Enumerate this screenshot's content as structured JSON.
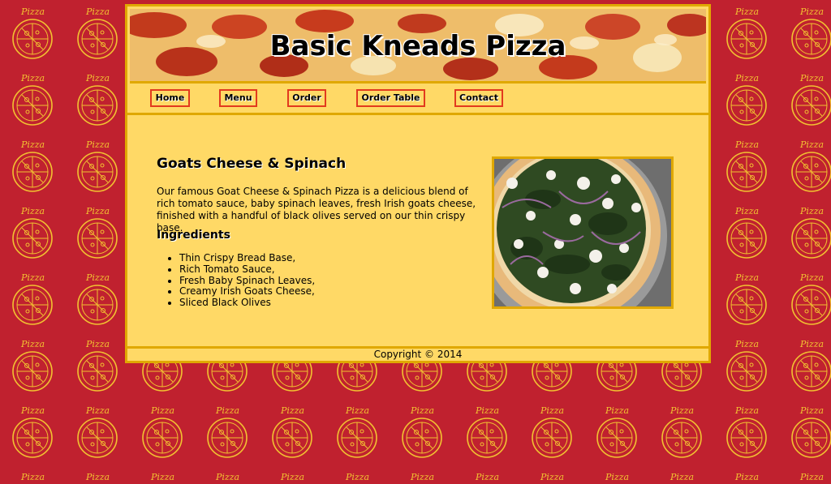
{
  "site": {
    "title": "Basic Kneads Pizza",
    "background_pattern_text": "Pizza"
  },
  "nav": {
    "items": [
      {
        "label": "Home"
      },
      {
        "label": "Menu"
      },
      {
        "label": "Order"
      },
      {
        "label": "Order Table"
      },
      {
        "label": "Contact"
      }
    ]
  },
  "main": {
    "pizza_name": "Goats Cheese & Spinach",
    "description": "Our famous Goat Cheese & Spinach Pizza is a delicious blend of rich tomato sauce, baby spinach leaves, fresh Irish goats cheese, finished with a handful of black olives served on our thin crispy base.",
    "ingredients_heading": "Ingredients",
    "ingredients": [
      "Thin Crispy Bread Base,",
      "Rich Tomato Sauce,",
      "Fresh Baby Spinach Leaves,",
      "Creamy Irish Goats Cheese,",
      "Sliced Black Olives"
    ]
  },
  "footer": {
    "copyright": "Copyright © 2014"
  },
  "colors": {
    "page_background": "#c0212f",
    "pattern_line": "#f2c230",
    "panel": "#ffd966",
    "border": "#e0a800",
    "nav_border": "#e23a1e"
  }
}
